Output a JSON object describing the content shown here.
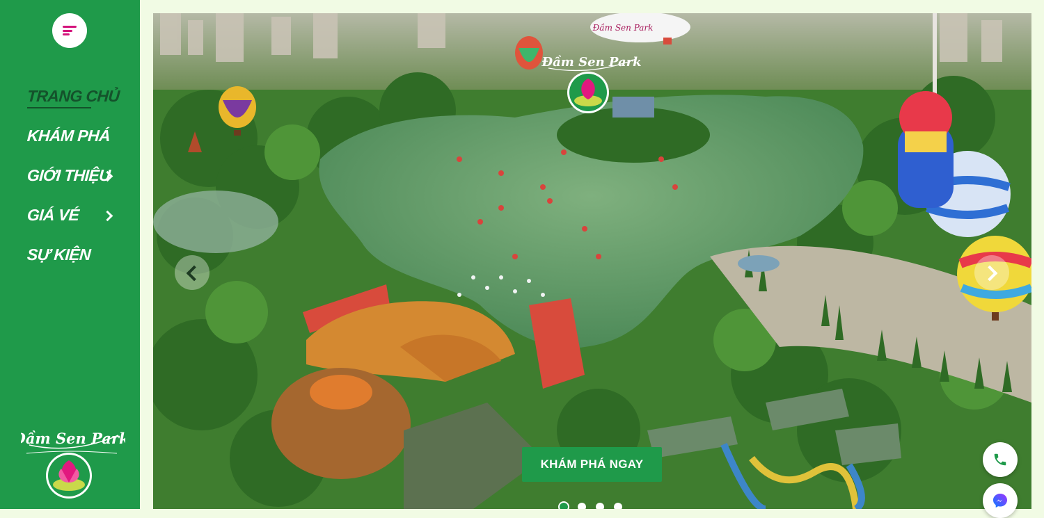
{
  "sidebar": {
    "menu_icon": "hamburger-icon",
    "nav": [
      {
        "label": "TRANG CHỦ",
        "active": true
      },
      {
        "label": "KHÁM PHÁ"
      },
      {
        "label": "GIỚI THIỆU",
        "has_submenu": true
      },
      {
        "label": "GIÁ VÉ",
        "has_submenu": true
      },
      {
        "label": "SỰ KIỆN"
      }
    ],
    "logo_text": "Đầm Sen Park"
  },
  "hero": {
    "cta_label": "KHÁM PHÁ NGAY",
    "slides_count": 4,
    "active_slide": 1,
    "logo_text": "Đầm Sen Park",
    "blimp_text": "Đầm Sen Park"
  },
  "floating": {
    "phone_icon": "phone-icon",
    "messenger_icon": "messenger-icon"
  },
  "colors": {
    "brand_green": "#1f9a4a",
    "brand_pink": "#d4147c",
    "active_nav": "#14522b"
  }
}
